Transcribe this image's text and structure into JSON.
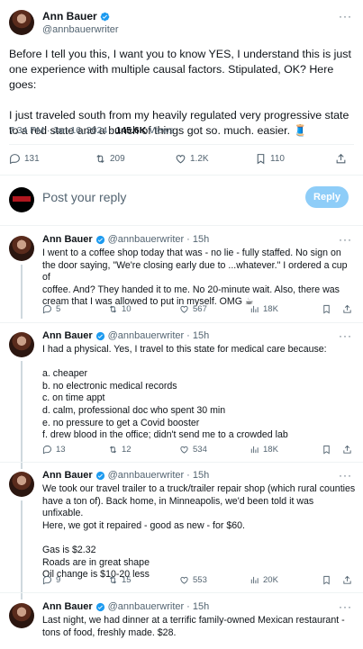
{
  "main_post": {
    "author_name": "Ann Bauer",
    "handle": "@annbauerwriter",
    "more_label": "···",
    "paragraphs": [
      "Before I tell you this, I want you to know YES, I understand this is just one experience with multiple causal factors. Stipulated, OK? Here goes:",
      "I just traveled south from my heavily regulated very progressive state to a red state and a bunch of things got so. much. easier. 🧵"
    ],
    "timestamp": "7:34 PM · Jan 16, 2024 · ",
    "views_count": "145.6K",
    "views_label": " Views",
    "actions": {
      "replies": "131",
      "reposts": "209",
      "likes": "1.2K",
      "bookmarks": "110"
    }
  },
  "reply_box": {
    "placeholder": "Post your reply",
    "button_label": "Reply"
  },
  "replies": [
    {
      "name": "Ann Bauer",
      "handle": "@annbauerwriter",
      "sep": "·",
      "time": "15h",
      "lines": [
        "I went to a coffee shop today that was - no lie - fully staffed. No sign on",
        "the door saying, \"We're closing early due to ...whatever.\" I ordered a cup of",
        "coffee. And? They handed it to me. No 20-minute wait. Also, there was",
        "cream that I was allowed to put in myself. OMG ☕"
      ],
      "actions": {
        "replies": "5",
        "reposts": "10",
        "likes": "567",
        "views": "18K"
      }
    },
    {
      "name": "Ann Bauer",
      "handle": "@annbauerwriter",
      "sep": "·",
      "time": "15h",
      "lines": [
        "I had a physical. Yes, I travel to this state for medical care because:",
        "",
        "a. cheaper",
        "b. no electronic medical records",
        "c. on time appt",
        "d. calm, professional doc who spent 30 min",
        "e. no pressure to get a Covid booster",
        "f. drew blood in the office; didn't send me to a crowded lab"
      ],
      "actions": {
        "replies": "13",
        "reposts": "12",
        "likes": "534",
        "views": "18K"
      }
    },
    {
      "name": "Ann Bauer",
      "handle": "@annbauerwriter",
      "sep": "·",
      "time": "15h",
      "lines": [
        "We took our travel trailer to a truck/trailer repair shop (which rural counties",
        "have a ton of). Back home, in Minneapolis, we'd been told it was unfixable.",
        "Here, we got it repaired - good as new - for $60.",
        "",
        "Gas is $2.32",
        "Roads are in great shape",
        "Oil change is $10-20 less"
      ],
      "actions": {
        "replies": "9",
        "reposts": "15",
        "likes": "553",
        "views": "20K"
      }
    },
    {
      "name": "Ann Bauer",
      "handle": "@annbauerwriter",
      "sep": "·",
      "time": "15h",
      "lines": [
        "Last night, we had dinner at a terrific family-owned Mexican restaurant -",
        "tons of food, freshly made. $28."
      ]
    }
  ],
  "colors": {
    "accent": "#1d9bf0",
    "reply_button_disabled": "#8ecdf8",
    "muted_text": "#536471",
    "divider": "#eff3f4"
  }
}
